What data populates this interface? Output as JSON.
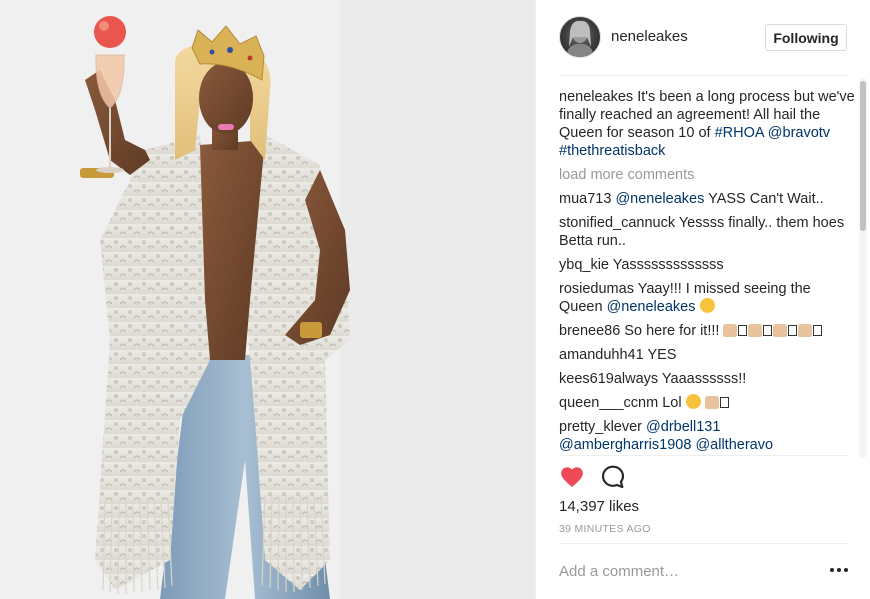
{
  "post": {
    "image_alt": "",
    "author": "neneleakes",
    "follow_label": "Following",
    "likes": "14,397 likes",
    "timestamp": "39 MINUTES AGO",
    "comment_placeholder": "Add a comment…"
  },
  "caption": {
    "username": "neneleakes",
    "text": " It's been a long process but we've finally reached an agreement! All hail the Queen for season 10 of ",
    "hashtag1": "#RHOA",
    "mention": "@bravotv",
    "hashtag2": "#thethreatisback"
  },
  "load_more": "load more comments",
  "comments": [
    {
      "username": "mua713",
      "mention": "@neneleakes",
      "text": " YASS Can't Wait.."
    },
    {
      "username": "stonified_cannuck",
      "text": " Yessss finally.. them hoes Betta run.."
    },
    {
      "username": "ybq_kie",
      "text": " Yasssssssssssss"
    },
    {
      "username": "rosiedumas",
      "text": " Yaay!!! I missed seeing the Queen ",
      "mention": "@neneleakes"
    },
    {
      "username": "brenee86",
      "text": " So here for it!!! "
    },
    {
      "username": "amanduhh41",
      "text": " YES"
    },
    {
      "username": "kees619",
      "text": "always Yaaassssss!!"
    },
    {
      "username": "queen___ccnm",
      "text": " Lol "
    },
    {
      "username": "pretty_klever",
      "mention": "@drbell131",
      "mention2": "@ambergharris1908",
      "mention3": "@alltheravo"
    }
  ],
  "colors": {
    "like_heart": "#ed4956",
    "link": "#003569",
    "muted": "#999999",
    "text": "#262626"
  },
  "icons": {
    "like": "heart-icon",
    "comment": "speech-bubble-icon",
    "more": "ellipsis-icon"
  }
}
